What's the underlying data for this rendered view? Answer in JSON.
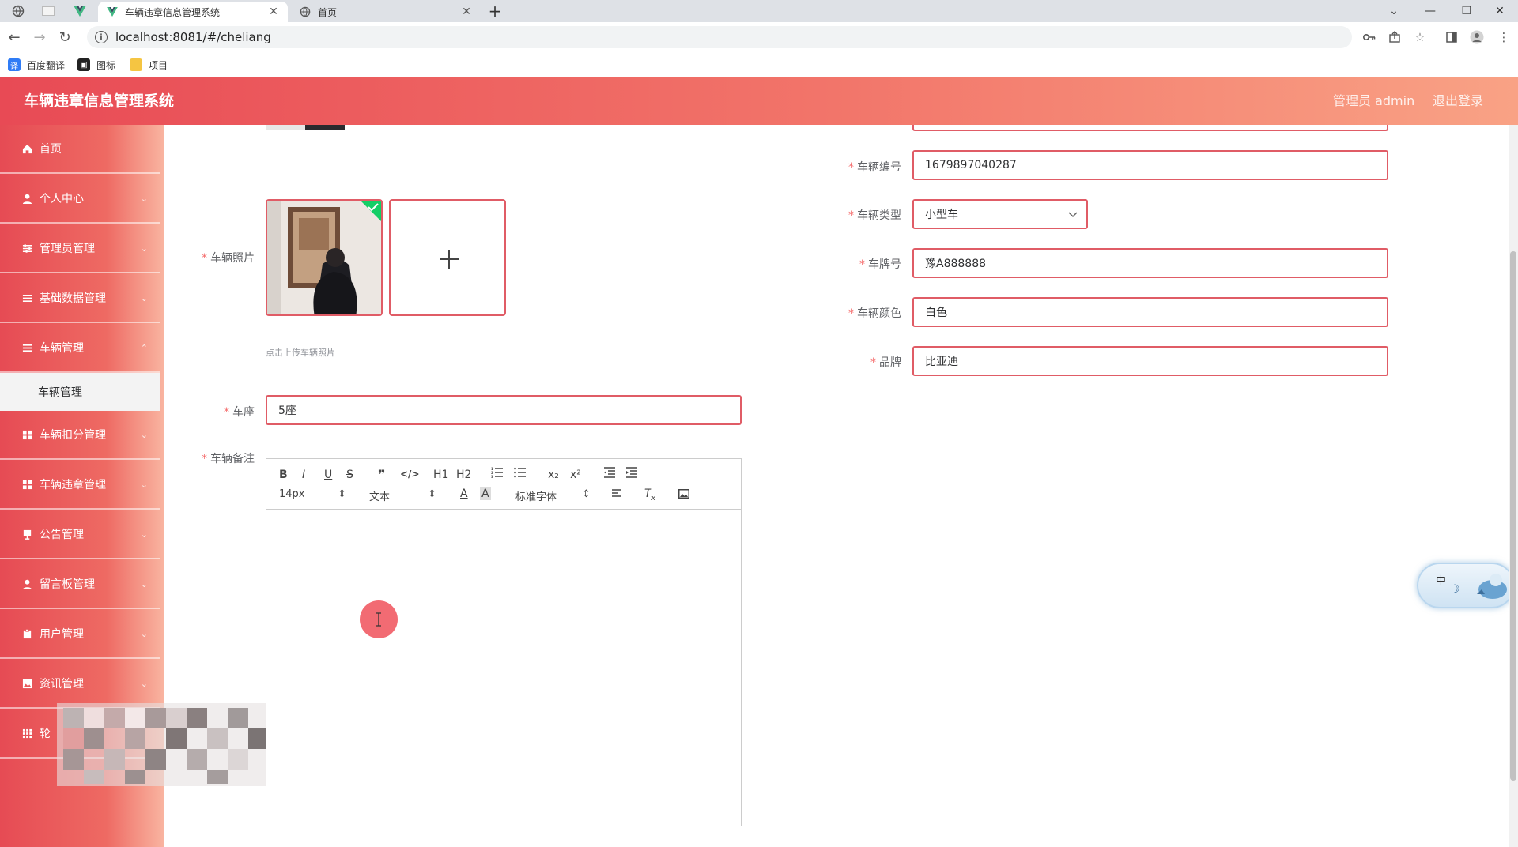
{
  "browser": {
    "tabs": [
      {
        "title": "车辆违章信息管理系统",
        "active": true
      },
      {
        "title": "首页",
        "active": false
      }
    ],
    "url": "localhost:8081/#/cheliang",
    "bookmarks": [
      "百度翻译",
      "图标",
      "项目"
    ]
  },
  "header": {
    "title": "车辆违章信息管理系统",
    "user": "管理员 admin",
    "logout": "退出登录"
  },
  "sidebar": {
    "items": [
      {
        "label": "首页",
        "icon": "home-icon"
      },
      {
        "label": "个人中心",
        "icon": "user-icon"
      },
      {
        "label": "管理员管理",
        "icon": "sliders-icon"
      },
      {
        "label": "基础数据管理",
        "icon": "list-icon"
      },
      {
        "label": "车辆管理",
        "icon": "list-icon"
      },
      {
        "label": "车辆扣分管理",
        "icon": "grid-icon"
      },
      {
        "label": "车辆违章管理",
        "icon": "grid-icon"
      },
      {
        "label": "公告管理",
        "icon": "notice-icon"
      },
      {
        "label": "留言板管理",
        "icon": "user-icon"
      },
      {
        "label": "用户管理",
        "icon": "clipboard-icon"
      },
      {
        "label": "资讯管理",
        "icon": "image-icon"
      },
      {
        "label": "轮",
        "icon": "grid-icon"
      }
    ],
    "sub_item": "车辆管理"
  },
  "form": {
    "photo_label": "车辆照片",
    "upload_tip": "点击上传车辆照片",
    "seat_label": "车座",
    "seat_value": "5座",
    "remark_label": "车辆备注",
    "number_label": "车辆编号",
    "number_value": "1679897040287",
    "type_label": "车辆类型",
    "type_value": "小型车",
    "plate_label": "车牌号",
    "plate_value": "豫A888888",
    "color_label": "车辆颜色",
    "color_value": "白色",
    "brand_label": "品牌",
    "brand_value": "比亚迪"
  },
  "editor": {
    "font_size": "14px",
    "block": "文本",
    "font": "标准字体",
    "h1": "H1",
    "h2": "H2"
  },
  "ime": {
    "label": "中"
  },
  "colors": {
    "accent": "#e84a55",
    "border": "#e05c66"
  }
}
